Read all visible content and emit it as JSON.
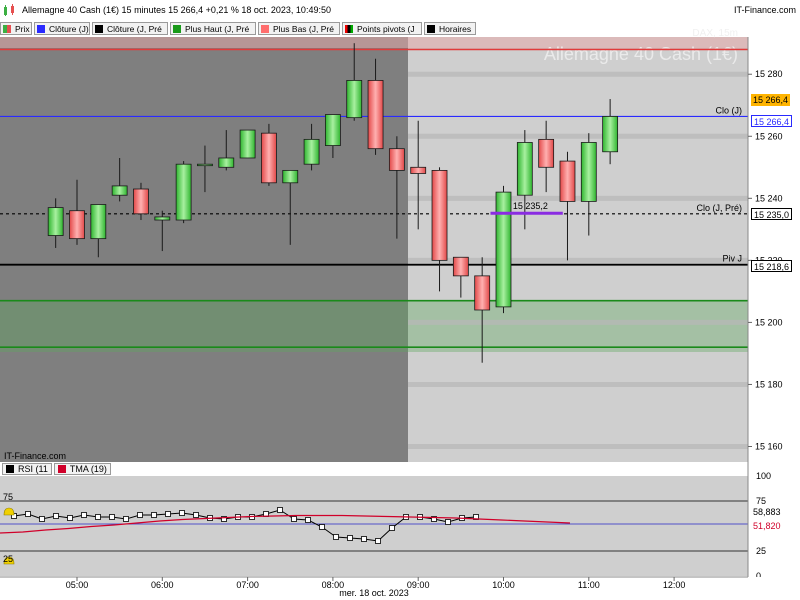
{
  "header": {
    "title": "Allemagne 40 Cash (1€) 15 minutes 15 266,4 +0,21 % 18 oct. 2023, 10:49:50",
    "brand": "IT-Finance.com"
  },
  "legend": [
    {
      "label": "Prix",
      "color": "#3cb043",
      "icon": "candle-icon"
    },
    {
      "label": "Clôture (J)",
      "color": "#2a2aff"
    },
    {
      "label": "Clôture (J, Pré",
      "color": "#000000"
    },
    {
      "label": "Plus Haut (J, Pré",
      "color": "#1a9a1a"
    },
    {
      "label": "Plus Bas (J, Pré",
      "color": "#ff6d6d"
    },
    {
      "label": "Points pivots (J",
      "color": "#000000",
      "icon": "pivot-icon"
    },
    {
      "label": "Horaires",
      "color": "#000000"
    }
  ],
  "watermark": {
    "line1": "DAX, 15m",
    "line2": "Allemagne 40 Cash (1€)"
  },
  "copyright": "IT-Finance.com",
  "chart_data": [
    {
      "type": "candlestick",
      "title": "Allemagne 40 Cash (1€) 15 minutes",
      "x_ticks": [
        "05:00",
        "06:00",
        "07:00",
        "08:00",
        "09:00",
        "10:00",
        "11:00",
        "12:00"
      ],
      "x_caption": "mer. 18 oct. 2023",
      "y_ticks": [
        "15 280",
        "15 260",
        "15 240",
        "15 220",
        "15 200",
        "15 180",
        "15 160"
      ],
      "ylim": [
        15155,
        15292
      ],
      "candles": [
        {
          "time": "04:45",
          "o": 15228,
          "h": 15240,
          "l": 15224,
          "c": 15237
        },
        {
          "time": "05:00",
          "o": 15236,
          "h": 15246,
          "l": 15225,
          "c": 15227
        },
        {
          "time": "05:15",
          "o": 15227,
          "h": 15238,
          "l": 15221,
          "c": 15238
        },
        {
          "time": "05:30",
          "o": 15241,
          "h": 15253,
          "l": 15239,
          "c": 15244
        },
        {
          "time": "05:45",
          "o": 15243,
          "h": 15245,
          "l": 15233,
          "c": 15235
        },
        {
          "time": "06:00",
          "o": 15233,
          "h": 15236,
          "l": 15223,
          "c": 15234
        },
        {
          "time": "06:15",
          "o": 15233,
          "h": 15252,
          "l": 15232,
          "c": 15251
        },
        {
          "time": "06:30",
          "o": 15251,
          "h": 15257,
          "l": 15242,
          "c": 15251
        },
        {
          "time": "06:45",
          "o": 15250,
          "h": 15262,
          "l": 15249,
          "c": 15253
        },
        {
          "time": "07:00",
          "o": 15253,
          "h": 15262,
          "l": 15253,
          "c": 15262
        },
        {
          "time": "07:15",
          "o": 15261,
          "h": 15264,
          "l": 15244,
          "c": 15245
        },
        {
          "time": "07:30",
          "o": 15245,
          "h": 15249,
          "l": 15225,
          "c": 15249
        },
        {
          "time": "07:45",
          "o": 15251,
          "h": 15264,
          "l": 15249,
          "c": 15259
        },
        {
          "time": "08:00",
          "o": 15257,
          "h": 15265,
          "l": 15253,
          "c": 15267
        },
        {
          "time": "08:15",
          "o": 15266,
          "h": 15290,
          "l": 15265,
          "c": 15278
        },
        {
          "time": "08:30",
          "o": 15278,
          "h": 15285,
          "l": 15254,
          "c": 15256
        },
        {
          "time": "08:45",
          "o": 15256,
          "h": 15260,
          "l": 15227,
          "c": 15249
        },
        {
          "time": "09:00",
          "o": 15250,
          "h": 15265,
          "l": 15230,
          "c": 15248
        },
        {
          "time": "09:15",
          "o": 15249,
          "h": 15250,
          "l": 15210,
          "c": 15220
        },
        {
          "time": "09:30",
          "o": 15221,
          "h": 15221,
          "l": 15208,
          "c": 15215
        },
        {
          "time": "09:45",
          "o": 15215,
          "h": 15221,
          "l": 15187,
          "c": 15204
        },
        {
          "time": "10:00",
          "o": 15205,
          "h": 15244,
          "l": 15203,
          "c": 15242
        },
        {
          "time": "10:15",
          "o": 15241,
          "h": 15262,
          "l": 15230,
          "c": 15258
        },
        {
          "time": "10:30",
          "o": 15259,
          "h": 15265,
          "l": 15242,
          "c": 15250
        },
        {
          "time": "10:45",
          "o": 15252,
          "h": 15255,
          "l": 15220,
          "c": 15239
        },
        {
          "time": "11:00",
          "o": 15239,
          "h": 15261,
          "l": 15228,
          "c": 15258
        },
        {
          "time": "11:15",
          "o": 15255,
          "h": 15272,
          "l": 15251,
          "c": 15266.4
        }
      ],
      "levels": [
        {
          "name": "Clo (J)",
          "value": 15266.4,
          "color": "#2a2aff",
          "label": "Clo (J)",
          "tag": "15 266,4"
        },
        {
          "name": "Clo (J, Pré)",
          "value": 15235.0,
          "color": "#000000",
          "label": "Clo (J, Pré)",
          "tag": "15 235,0"
        },
        {
          "name": "Piv J",
          "value": 15218.6,
          "color": "#000000",
          "label": "Piv J",
          "tag": "15 218,6"
        },
        {
          "name": "Plus Bas (J, Pré)",
          "value": 15288,
          "color": "#e23a3a"
        },
        {
          "name": "Plus Haut (J, Pré)",
          "value": 15207,
          "color": "#1a8a1a"
        },
        {
          "name": "Plus Haut band low",
          "value": 15192,
          "color": "#1a8a1a"
        }
      ],
      "last_price_tag": "15 266,4",
      "marker": {
        "label": "15 235,2",
        "value": 15235.2
      }
    },
    {
      "type": "line",
      "title": "RSI",
      "series": [
        {
          "name": "RSI (11)",
          "color": "#000000",
          "values": [
            60,
            62,
            57,
            60,
            58,
            61,
            59,
            59,
            57,
            61,
            61,
            62,
            63,
            61,
            58,
            57,
            59,
            59,
            62,
            66,
            57,
            56,
            49,
            39,
            38,
            37,
            35,
            48,
            59,
            59,
            57,
            54,
            58,
            59
          ]
        },
        {
          "name": "TMA (19)",
          "color": "#d0002a",
          "values": [
            43,
            44,
            46,
            47.5,
            49.5,
            51,
            53,
            55,
            56.5,
            57.5,
            58.5,
            59.5,
            60,
            60.5,
            60.5,
            60.5,
            60,
            59.5,
            59,
            58.5,
            58,
            57,
            56,
            55,
            54,
            53
          ]
        }
      ],
      "ylim": [
        0,
        100
      ],
      "y_ticks": [
        "100",
        "75",
        "25",
        "0"
      ],
      "values_shown": {
        "rsi": "58,883",
        "tma": "51,820"
      }
    }
  ],
  "indicator_legend": [
    {
      "label": "RSI (11",
      "color": "#000000"
    },
    {
      "label": "TMA (19)",
      "color": "#d0002a"
    }
  ]
}
